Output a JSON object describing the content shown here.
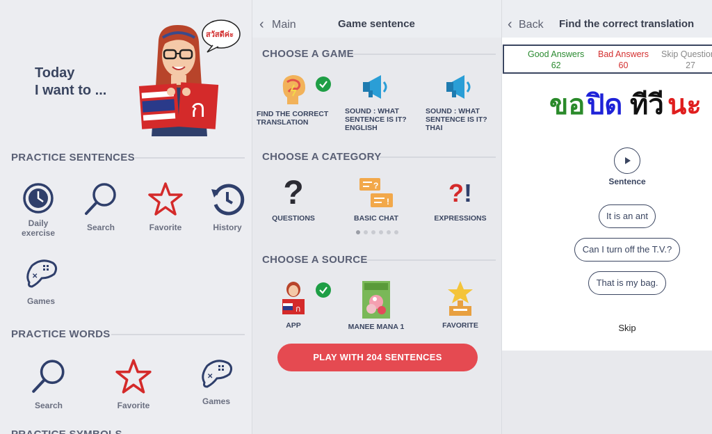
{
  "screen1": {
    "hero": {
      "line1": "Today",
      "line2": "I want to ...",
      "speech_text": "สวัสดีค่ะ"
    },
    "practice_sentences": {
      "title": "PRACTICE SENTENCES",
      "items": [
        {
          "label": "Daily exercise",
          "icon": "clock-icon"
        },
        {
          "label": "Search",
          "icon": "magnifier-icon"
        },
        {
          "label": "Favorite",
          "icon": "star-icon"
        },
        {
          "label": "History",
          "icon": "history-icon"
        },
        {
          "label": "Games",
          "icon": "gamepad-icon"
        }
      ]
    },
    "practice_words": {
      "title": "PRACTICE WORDS",
      "items": [
        {
          "label": "Search",
          "icon": "magnifier-icon"
        },
        {
          "label": "Favorite",
          "icon": "star-icon"
        },
        {
          "label": "Games",
          "icon": "gamepad-icon"
        }
      ]
    },
    "practice_symbols": {
      "title": "PRACTICE SYMBOLS"
    }
  },
  "screen2": {
    "back_label": "Main",
    "title": "Game sentence",
    "choose_game": {
      "title": "CHOOSE A GAME",
      "items": [
        {
          "label": "FIND THE CORRECT TRANSLATION",
          "icon": "brain-icon",
          "selected": true
        },
        {
          "label": "SOUND : WHAT SENTENCE IS IT? ENGLISH",
          "icon": "megaphone-icon",
          "selected": false
        },
        {
          "label": "SOUND : WHAT SENTENCE IS IT? THAI",
          "icon": "megaphone-icon",
          "selected": false
        }
      ]
    },
    "choose_category": {
      "title": "CHOOSE A CATEGORY",
      "items": [
        {
          "label": "QUESTIONS",
          "icon": "question-icon"
        },
        {
          "label": "BASIC CHAT",
          "icon": "chat-bubbles-icon"
        },
        {
          "label": "EXPRESSIONS",
          "icon": "exclamation-icon"
        }
      ],
      "page_count": 6,
      "current_page": 1
    },
    "choose_source": {
      "title": "CHOOSE A SOURCE",
      "items": [
        {
          "label": "APP",
          "icon": "app-girl-icon",
          "selected": true
        },
        {
          "label": "MANEE MANA 1",
          "icon": "book-cover-icon",
          "selected": false
        },
        {
          "label": "FAVORITE",
          "icon": "trophy-star-icon",
          "selected": false
        }
      ]
    },
    "play_button": "PLAY WITH 204 SENTENCES"
  },
  "screen3": {
    "back_label": "Back",
    "title": "Find the correct translation",
    "scores": {
      "good_label": "Good Answers",
      "good_value": "62",
      "bad_label": "Bad Answers",
      "bad_value": "60",
      "skip_label": "Skip Questions",
      "skip_value": "27"
    },
    "thai_words": [
      {
        "text": "ขอ",
        "color": "#2a8a2a"
      },
      {
        "text": "ปิด",
        "color": "#1e22d8"
      },
      {
        "text": "ทีวี",
        "color": "#111111"
      },
      {
        "text": "นะ",
        "color": "#e01e1e"
      }
    ],
    "sentence_label": "Sentence",
    "answers": [
      "It is an ant",
      "Can I turn off the T.V.?",
      "That is my bag."
    ],
    "skip_label": "Skip"
  },
  "colors": {
    "navy": "#2f3f6b",
    "red": "#d42a2a",
    "play_button": "#e54a51",
    "check": "#1e9e45"
  }
}
